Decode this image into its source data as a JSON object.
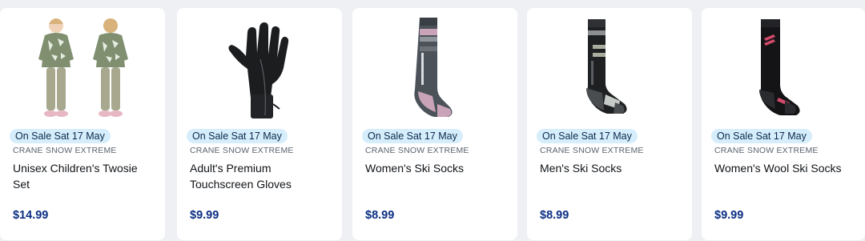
{
  "products": [
    {
      "badge": "On Sale Sat 17 May",
      "brand": "CRANE SNOW EXTREME",
      "name": "Unisex Children's Twosie Set",
      "price": "$14.99",
      "image": "kids-twosie-set-image"
    },
    {
      "badge": "On Sale Sat 17 May",
      "brand": "CRANE SNOW EXTREME",
      "name": "Adult's Premium Touchscreen Gloves",
      "price": "$9.99",
      "image": "touchscreen-glove-image"
    },
    {
      "badge": "On Sale Sat 17 May",
      "brand": "CRANE SNOW EXTREME",
      "name": "Women's Ski Socks",
      "price": "$8.99",
      "image": "womens-ski-sock-image"
    },
    {
      "badge": "On Sale Sat 17 May",
      "brand": "CRANE SNOW EXTREME",
      "name": "Men's Ski Socks",
      "price": "$8.99",
      "image": "mens-ski-sock-image"
    },
    {
      "badge": "On Sale Sat 17 May",
      "brand": "CRANE SNOW EXTREME",
      "name": "Women's Wool Ski Socks",
      "price": "$9.99",
      "image": "womens-wool-ski-sock-image"
    }
  ],
  "colors": {
    "badge_bg": "#d6eefc",
    "price": "#0b2e83",
    "card_bg": "#ffffff",
    "page_bg": "#eef0f3"
  }
}
